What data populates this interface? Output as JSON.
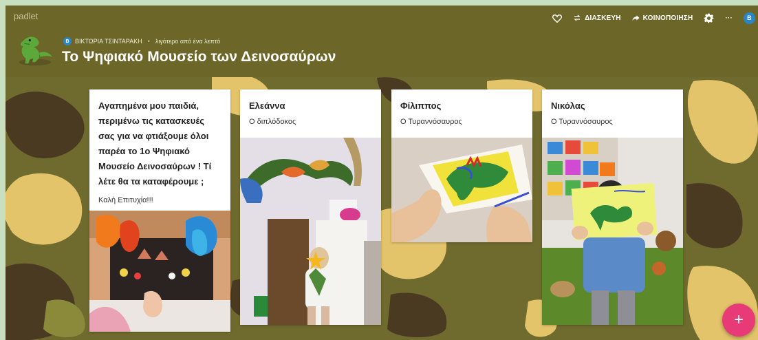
{
  "app": {
    "brand": "padlet"
  },
  "topbar": {
    "remake_label": "ΔΙΑΣΚΕΥΗ",
    "share_label": "ΚΟΙΝΟΠΟΙΗΣΗ",
    "more_label": "···",
    "user_initial": "B"
  },
  "board": {
    "author_initial": "B",
    "author": "ΒΙΚΤΩΡΙΑ ΤΣΙΝΤΑΡΑΚΗ",
    "separator": "•",
    "time": "λιγότερο από ένα λεπτό",
    "title": "Το Ψηφιακό Μουσείο των Δεινοσαύρων"
  },
  "posts": [
    {
      "title": "Αγαπημένα μου παιδιά, περιμένω τις κατασκευές σας για να φτιάξουμε όλοι παρέα το 1ο Ψηφιακό Μουσείο Δεινοσαύρων ! Τί λέτε θα τα καταφέρουμε ;",
      "subtitle": "Καλή Επιτυχία!!!"
    },
    {
      "title": "Ελεάννα",
      "subtitle": "Ο διπλόδοκος"
    },
    {
      "title": "Φίλιππος",
      "subtitle": "Ο Τυραννόσαυρος"
    },
    {
      "title": "Νικόλας",
      "subtitle": "Ο Τυραννόσαυρος"
    }
  ],
  "add_post": {
    "label": "+"
  },
  "colors": {
    "header": "#6c6628",
    "camo_olive": "#6f6a2e",
    "camo_sand": "#e3c46a",
    "camo_brown": "#4a3a22",
    "accent_pink": "#e93a78",
    "avatar_blue": "#2a86c7"
  }
}
